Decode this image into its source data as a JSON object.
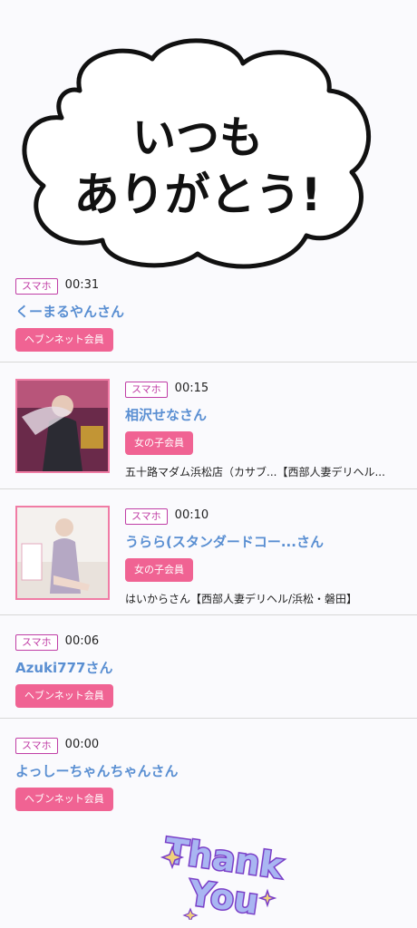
{
  "header_image": {
    "text_line1": "いつも",
    "text_line2": "ありがとう!"
  },
  "visitors": [
    {
      "device": "スマホ",
      "time": "00:31",
      "name": "くーまるやんさん",
      "member": "ヘブンネット会員",
      "shop": ""
    },
    {
      "device": "スマホ",
      "time": "00:15",
      "name": "相沢せなさん",
      "member": "女の子会員",
      "shop": "五十路マダム浜松店（カサブ...【西部人妻デリヘル..."
    },
    {
      "device": "スマホ",
      "time": "00:10",
      "name": "うらら(スタンダードコー...さん",
      "member": "女の子会員",
      "shop": "はいからさん【西部人妻デリヘル/浜松・磐田】"
    },
    {
      "device": "スマホ",
      "time": "00:06",
      "name": "Azuki777さん",
      "member": "ヘブンネット会員",
      "shop": ""
    },
    {
      "device": "スマホ",
      "time": "00:00",
      "name": "よっしーちゃんちゃんさん",
      "member": "ヘブンネット会員",
      "shop": ""
    }
  ],
  "footer_image": {
    "line1": "Thank",
    "line2": "You"
  },
  "colors": {
    "badge": "#c03ea6",
    "name": "#5a8fd2",
    "member_button": "#f06393",
    "thumb_border": "#f07ca5"
  }
}
